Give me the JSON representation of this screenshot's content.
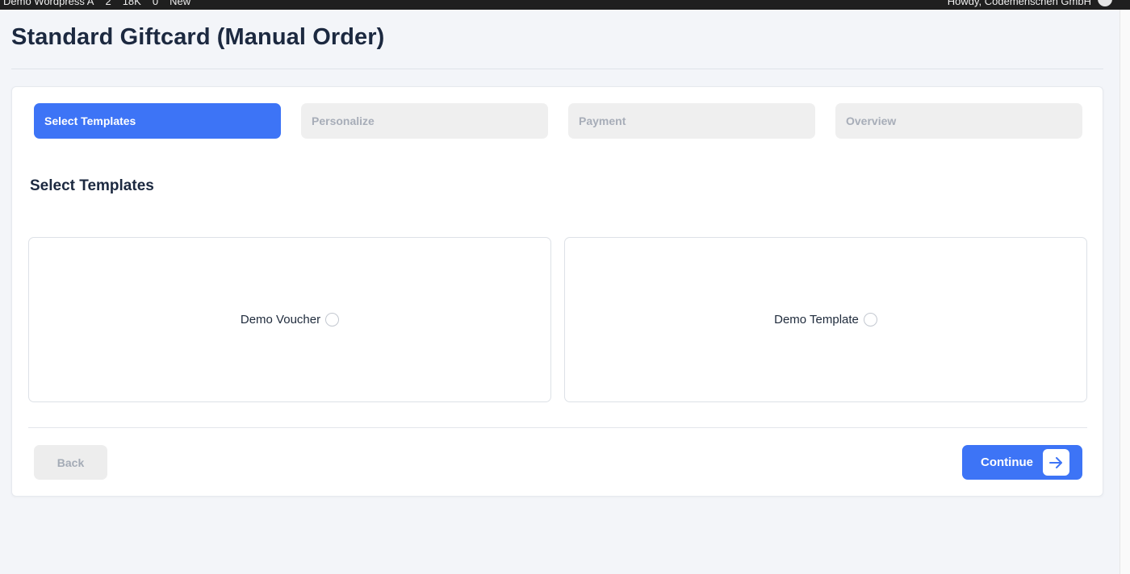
{
  "admin_bar": {
    "site_name": "Demo Wordpress A",
    "comments_count": "2",
    "views": "18K",
    "updates": "0",
    "new_label": "New",
    "greeting": "Howdy, Codemenschen GmbH"
  },
  "page": {
    "title": "Standard Giftcard (Manual Order)"
  },
  "steps": [
    {
      "label": "Select Templates",
      "active": true
    },
    {
      "label": "Personalize",
      "active": false
    },
    {
      "label": "Payment",
      "active": false
    },
    {
      "label": "Overview",
      "active": false
    }
  ],
  "section": {
    "title": "Select Templates"
  },
  "templates": [
    {
      "name": "Demo Voucher",
      "selected": false
    },
    {
      "name": "Demo Template",
      "selected": false
    }
  ],
  "buttons": {
    "back": "Back",
    "continue": "Continue"
  },
  "colors": {
    "accent": "#3d74f6",
    "inactive_step": "#efefef",
    "admin_bar": "#1f1f1f"
  }
}
